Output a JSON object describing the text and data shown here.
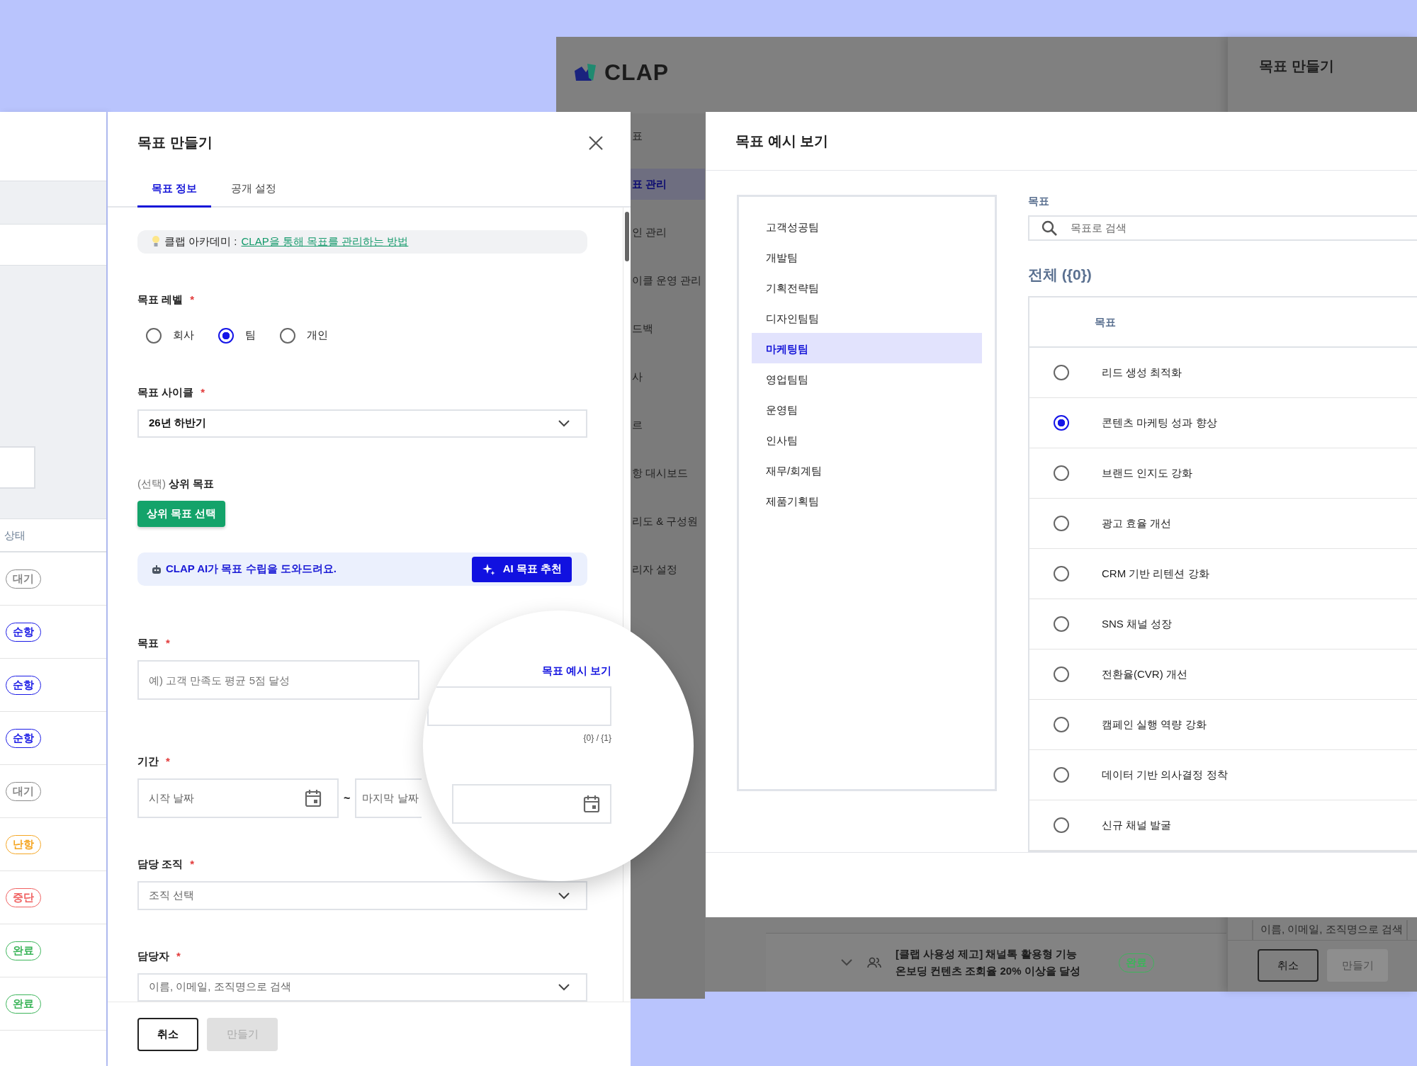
{
  "background_app": {
    "logo": "CLAP",
    "sidebar_items": [
      {
        "label": "표",
        "selected": false
      },
      {
        "label": "표 관리",
        "selected": true
      },
      {
        "label": "인 관리",
        "selected": false
      },
      {
        "label": "이클 운영 관리",
        "selected": false
      },
      {
        "label": "드백",
        "selected": false
      },
      {
        "label": "사",
        "selected": false
      },
      {
        "label": "르",
        "selected": false
      },
      {
        "label": "항 대시보드",
        "selected": false
      },
      {
        "label": "리도 & 구성원",
        "selected": false
      },
      {
        "label": "리자 설정",
        "selected": false
      }
    ],
    "goal_row": {
      "title": "[클랩 사용성 제고] 채널톡 활용형 기능온보딩 컨텐츠 조회율 20% 이상을 달성",
      "status": "완료",
      "color": "#3cb55a"
    },
    "drawer": {
      "title": "목표 만들기",
      "assignee_placeholder": "이름, 이메일, 조직명으로 검색",
      "buttons": [
        {
          "label": "취소",
          "disabled": false
        },
        {
          "label": "만들기",
          "disabled": true
        }
      ]
    }
  },
  "status_panel": {
    "column": "상태",
    "rows": [
      {
        "status": "대기",
        "color": "#8a8a8a"
      },
      {
        "status": "순항",
        "color": "#1a1ae6"
      },
      {
        "status": "순항",
        "color": "#1a1ae6"
      },
      {
        "status": "순항",
        "color": "#1a1ae6"
      },
      {
        "status": "대기",
        "color": "#8a8a8a"
      },
      {
        "status": "난항",
        "color": "#f5a623"
      },
      {
        "status": "중단",
        "color": "#f06060"
      },
      {
        "status": "완료",
        "color": "#3cb55a"
      },
      {
        "status": "완료",
        "color": "#3cb55a"
      }
    ]
  },
  "modal": {
    "title": "목표 만들기",
    "required_mark": "*",
    "tabs": [
      {
        "label": "목표 정보",
        "selected": true
      },
      {
        "label": "공개 설정",
        "selected": false
      }
    ],
    "academy": {
      "prefix": "클랩 아카데미 :",
      "link": "CLAP을 통해 목표를 관리하는 방법"
    },
    "level": {
      "label": "목표 레벨",
      "required": true,
      "options": [
        {
          "label": "회사",
          "selected": false
        },
        {
          "label": "팀",
          "selected": true
        },
        {
          "label": "개인",
          "selected": false
        }
      ]
    },
    "cycle": {
      "label": "목표 사이클",
      "required": true,
      "value": "26년 하반기"
    },
    "parent": {
      "optional_tag": "(선택)",
      "label": "상위 목표",
      "button": "상위 목표 선택"
    },
    "ai": {
      "message": "CLAP AI가 목표 수립을 도와드려요.",
      "button": "AI 목표 추천"
    },
    "goal": {
      "label": "목표",
      "required": true,
      "placeholder": "예) 고객 만족도 평균 5점 달성"
    },
    "period": {
      "label": "기간",
      "required": true,
      "start_placeholder": "시작 날짜",
      "separator": "~",
      "end_placeholder": "마지막 날짜"
    },
    "org": {
      "label": "담당 조직",
      "required": true,
      "placeholder": "조직 선택"
    },
    "owner": {
      "label": "담당자",
      "required": true,
      "placeholder": "이름, 이메일, 조직명으로 검색"
    },
    "buttons": [
      {
        "label": "취소",
        "disabled": false
      },
      {
        "label": "만들기",
        "disabled": true
      }
    ]
  },
  "magnifier": {
    "link": "목표 예시 보기",
    "counter": "{0} / {1}"
  },
  "example_panel": {
    "title": "목표 예시 보기",
    "teams": [
      {
        "label": "고객성공팀",
        "selected": false
      },
      {
        "label": "개발팀",
        "selected": false
      },
      {
        "label": "기획전략팀",
        "selected": false
      },
      {
        "label": "디자인팀팀",
        "selected": false
      },
      {
        "label": "마케팅팀",
        "selected": true
      },
      {
        "label": "영업팀팀",
        "selected": false
      },
      {
        "label": "운영팀",
        "selected": false
      },
      {
        "label": "인사팀",
        "selected": false
      },
      {
        "label": "재무/회계팀",
        "selected": false
      },
      {
        "label": "제품기획팀",
        "selected": false
      }
    ],
    "search_label": "목표",
    "search_placeholder": "목표로 검색",
    "total": "전체 ({0})",
    "column": "목표",
    "goals": [
      {
        "label": "리드 생성 최적화",
        "selected": false
      },
      {
        "label": "콘텐츠 마케팅 성과 향상",
        "selected": true
      },
      {
        "label": "브랜드 인지도 강화",
        "selected": false
      },
      {
        "label": "광고 효율 개선",
        "selected": false
      },
      {
        "label": "CRM 기반 리텐션 강화",
        "selected": false
      },
      {
        "label": "SNS 채널 성장",
        "selected": false
      },
      {
        "label": "전환율(CVR) 개선",
        "selected": false
      },
      {
        "label": "캠페인 실행 역량 강화",
        "selected": false
      },
      {
        "label": "데이터 기반 의사결정 정착",
        "selected": false
      },
      {
        "label": "신규 채널 발굴",
        "selected": false
      }
    ]
  }
}
